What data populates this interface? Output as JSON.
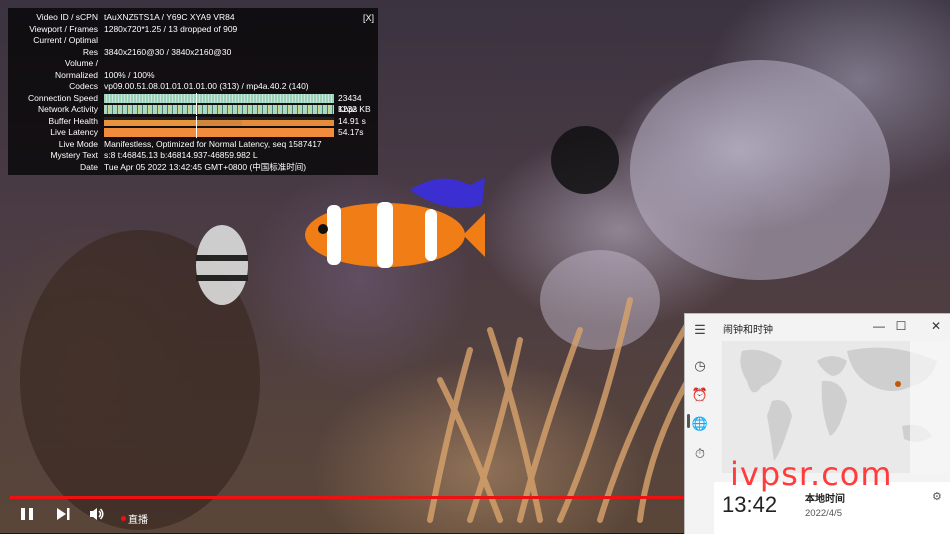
{
  "stats": {
    "close_label": "[X]",
    "rows": [
      {
        "key": "Video ID / sCPN",
        "value": "tAuXNZ5TS1A  /  Y69C XYA9 VR84"
      },
      {
        "key": "Viewport / Frames",
        "value": "1280x720*1.25 / 13 dropped of 909"
      },
      {
        "key": "Current / Optimal",
        "value": ""
      },
      {
        "key": "Res",
        "value": "3840x2160@30 / 3840x2160@30"
      },
      {
        "key": "Volume /",
        "value": ""
      },
      {
        "key": "Normalized",
        "value": "100% / 100%"
      },
      {
        "key": "Codecs",
        "value": "vp09.00.51.08.01.01.01.01.00 (313) / mp4a.40.2 (140)"
      },
      {
        "key": "Connection Speed",
        "value": "23434 Kbps"
      },
      {
        "key": "Network Activity",
        "value": "1232 KB"
      },
      {
        "key": "Buffer Health",
        "value": "14.91 s"
      },
      {
        "key": "Live Latency",
        "value": "54.17s"
      },
      {
        "key": "Live Mode",
        "value": "Manifestless, Optimized for Normal Latency, seq 1587417"
      },
      {
        "key": "Mystery Text",
        "value": "s:8 t:46845.13 b:46814.937-46859.982 L"
      },
      {
        "key": "Date",
        "value": "Tue Apr 05 2022 13:42:45 GMT+0800 (中国标准时间)"
      }
    ]
  },
  "player": {
    "live_label": "直播",
    "live_color": "#e11b1b",
    "progress_color": "#e11b1b",
    "icons": [
      "pause-icon",
      "next-icon",
      "volume-icon"
    ]
  },
  "clock_window": {
    "title": "闹钟和时钟",
    "nav_icons": [
      "menu-icon",
      "timer-icon",
      "alarm-icon",
      "world-clock-icon",
      "stopwatch-icon"
    ],
    "card": {
      "time": "13:42",
      "place": "本地时间",
      "date": "2022/4/5"
    }
  },
  "watermark": "ivpsr.com"
}
